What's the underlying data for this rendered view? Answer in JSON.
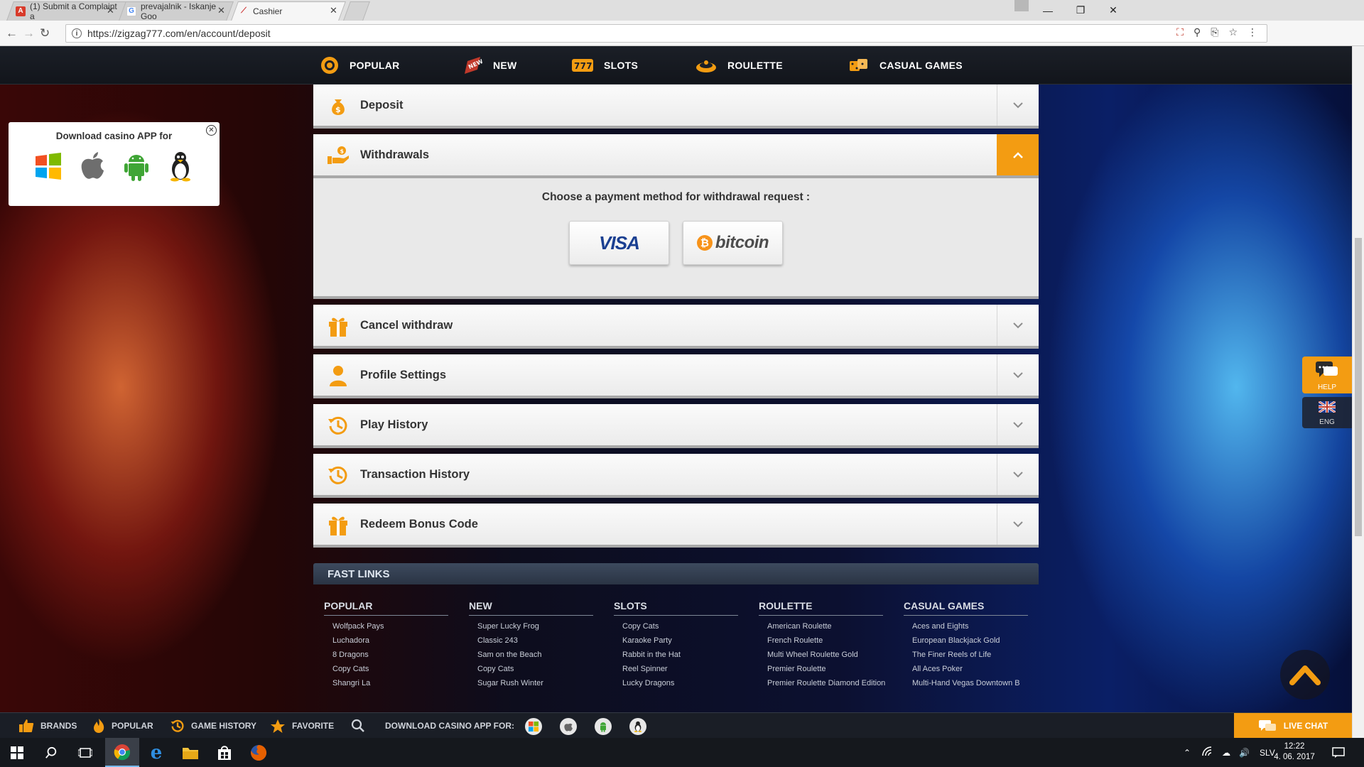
{
  "browser": {
    "tabs": [
      {
        "title": "(1) Submit a Complaint a",
        "icon": "complaint-favicon",
        "active": false
      },
      {
        "title": "prevajalnik - Iskanje Goo",
        "icon": "google-favicon",
        "active": false
      },
      {
        "title": "Cashier",
        "icon": "zigzag-favicon",
        "active": true
      }
    ],
    "url": "https://zigzag777.com/en/account/deposit"
  },
  "topnav": {
    "items": [
      {
        "label": "POPULAR",
        "icon": "chip-icon"
      },
      {
        "label": "NEW",
        "icon": "new-badge-icon"
      },
      {
        "label": "SLOTS",
        "icon": "slots-777-icon"
      },
      {
        "label": "ROULETTE",
        "icon": "roulette-icon"
      },
      {
        "label": "CASUAL GAMES",
        "icon": "dice-icon"
      }
    ]
  },
  "cashier": {
    "sections": [
      {
        "label": "Deposit",
        "icon": "money-bag-icon",
        "open": false
      },
      {
        "label": "Withdrawals",
        "icon": "hand-coin-icon",
        "open": true
      },
      {
        "label": "Cancel withdraw",
        "icon": "gift-icon",
        "open": false
      },
      {
        "label": "Profile Settings",
        "icon": "user-icon",
        "open": false
      },
      {
        "label": "Play History",
        "icon": "history-icon",
        "open": false
      },
      {
        "label": "Transaction History",
        "icon": "history-icon",
        "open": false
      },
      {
        "label": "Redeem Bonus Code",
        "icon": "gift-icon",
        "open": false
      }
    ],
    "withdrawal_panel": {
      "title": "Choose a payment method for withdrawal request :",
      "methods": [
        {
          "label": "VISA",
          "icon": "visa-logo"
        },
        {
          "label": "bitcoin",
          "icon": "bitcoin-logo"
        }
      ]
    }
  },
  "fast_links": {
    "title": "FAST LINKS",
    "columns": [
      {
        "heading": "POPULAR",
        "links": [
          "Wolfpack Pays",
          "Luchadora",
          "8 Dragons",
          "Copy Cats",
          "Shangri La"
        ]
      },
      {
        "heading": "NEW",
        "links": [
          "Super Lucky Frog",
          "Classic 243",
          "Sam on the Beach",
          "Copy Cats",
          "Sugar Rush Winter"
        ]
      },
      {
        "heading": "SLOTS",
        "links": [
          "Copy Cats",
          "Karaoke Party",
          "Rabbit in the Hat",
          "Reel Spinner",
          "Lucky Dragons"
        ]
      },
      {
        "heading": "ROULETTE",
        "links": [
          "American Roulette",
          "French Roulette",
          "Multi Wheel Roulette Gold",
          "Premier Roulette",
          "Premier Roulette Diamond Edition"
        ]
      },
      {
        "heading": "CASUAL GAMES",
        "links": [
          "Aces and Eights",
          "European Blackjack Gold",
          "The Finer Reels of Life",
          "All Aces Poker",
          "Multi-Hand Vegas Downtown B"
        ]
      }
    ]
  },
  "download_box": {
    "title": "Download casino APP for",
    "platforms": [
      "windows-icon",
      "apple-icon",
      "android-icon",
      "linux-icon"
    ]
  },
  "side_widgets": {
    "help_label": "HELP",
    "lang_label": "ENG"
  },
  "bottom_bar": {
    "brands": "BRANDS",
    "popular": "POPULAR",
    "game_history": "GAME HISTORY",
    "favorite": "FAVORITE",
    "download_label": "DOWNLOAD CASINO APP FOR:",
    "live_chat": "LIVE CHAT"
  },
  "taskbar": {
    "language": "SLV",
    "time": "12:22",
    "date": "4. 06. 2017"
  },
  "colors": {
    "accent": "#f39c12",
    "nav_bg": "#12151b",
    "visa_blue": "#1a3f91",
    "bitcoin_orange": "#f7931a"
  }
}
